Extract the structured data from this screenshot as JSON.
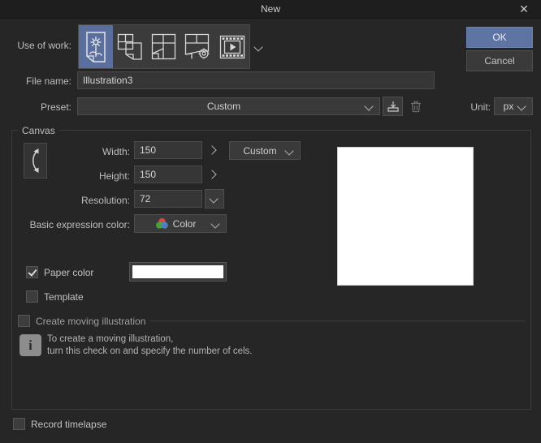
{
  "window": {
    "title": "New",
    "close_label": "✕"
  },
  "use_of_work": {
    "label": "Use of work:",
    "options": [
      {
        "name": "illustration",
        "selected": true
      },
      {
        "name": "multiple-pages",
        "selected": false
      },
      {
        "name": "comic-panels",
        "selected": false
      },
      {
        "name": "webtoon-settings",
        "selected": false
      },
      {
        "name": "animation",
        "selected": false
      }
    ],
    "more_label": "⌄"
  },
  "buttons": {
    "ok": "OK",
    "cancel": "Cancel",
    "ok_color": "#5e74a3"
  },
  "file_name": {
    "label": "File name:",
    "value": "Illustration3",
    "placeholder": "File name"
  },
  "preset": {
    "label": "Preset:",
    "value": "Custom",
    "save_icon": "save-preset-icon",
    "delete_icon": "delete-preset-icon"
  },
  "unit": {
    "label": "Unit:",
    "value": "px"
  },
  "canvas": {
    "group_title": "Canvas",
    "swap_icon": "swap-width-height-icon",
    "width": {
      "label": "Width:",
      "value": "150",
      "expand": "›"
    },
    "height": {
      "label": "Height:",
      "value": "150",
      "expand": "›"
    },
    "size_preset": {
      "value": "Custom"
    },
    "resolution": {
      "label": "Resolution:",
      "value": "72"
    },
    "expression_color": {
      "label": "Basic expression color:",
      "value": "Color",
      "icon": "rgb-circles-icon"
    },
    "paper_color": {
      "label": "Paper color",
      "checked": true,
      "swatch_color": "#ffffff"
    },
    "template": {
      "label": "Template",
      "checked": false
    },
    "moving_illustration": {
      "label": "Create moving illustration",
      "checked": false
    },
    "info": {
      "line1": "To create a moving illustration,",
      "line2": "turn this check on and specify the number of cels."
    }
  },
  "record_timelapse": {
    "label": "Record timelapse",
    "checked": false
  }
}
